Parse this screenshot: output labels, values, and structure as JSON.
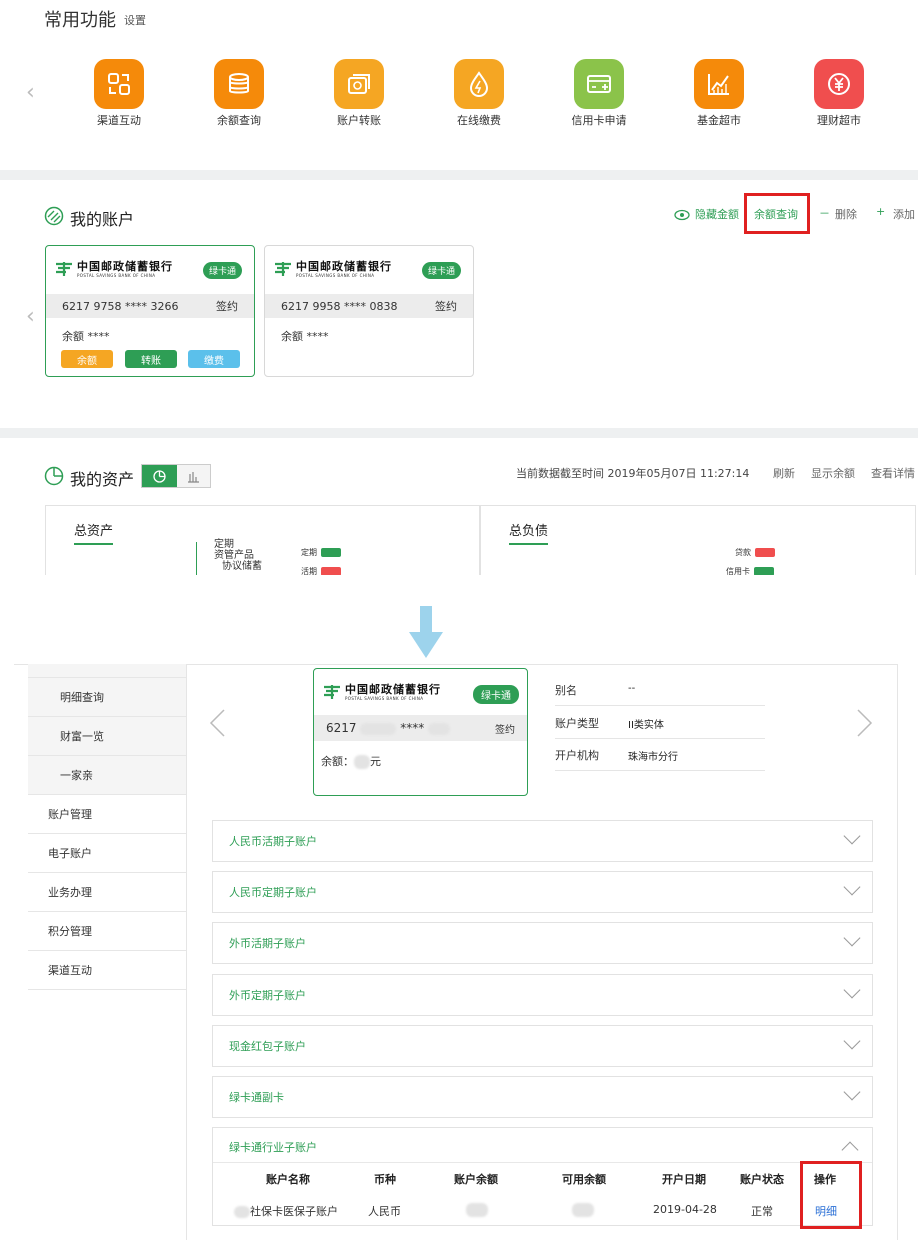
{
  "common": {
    "title": "常用功能",
    "settings": "设置",
    "items": [
      {
        "label": "渠道互动",
        "icon": "channel-interaction-icon",
        "color": "#f58a0a"
      },
      {
        "label": "余额查询",
        "icon": "balance-coins-icon",
        "color": "#f58a0a"
      },
      {
        "label": "账户转账",
        "icon": "transfer-icon",
        "color": "#f5a623"
      },
      {
        "label": "在线缴费",
        "icon": "payment-drop-icon",
        "color": "#f5a623"
      },
      {
        "label": "信用卡申请",
        "icon": "credit-card-icon",
        "color": "#8bc34a"
      },
      {
        "label": "基金超市",
        "icon": "fund-chart-icon",
        "color": "#f58a0a"
      },
      {
        "label": "理财超市",
        "icon": "yuan-coin-icon",
        "color": "#f04e4e"
      }
    ]
  },
  "accounts": {
    "title": "我的账户",
    "actions": {
      "hide": "隐藏金额",
      "query": "余额查询",
      "delete": "删除",
      "add": "添加"
    },
    "bank_name": "中国邮政储蓄银行",
    "bank_en": "POSTAL SAVINGS BANK OF CHINA",
    "cards": [
      {
        "badge": "绿卡通",
        "number": "6217 9758 **** 3266",
        "status": "签约",
        "balance": "余额 ****",
        "buttons": [
          "余额",
          "转账",
          "缴费"
        ]
      },
      {
        "badge": "绿卡通",
        "number": "6217 9958 **** 0838",
        "status": "签约",
        "balance": "余额 ****"
      }
    ]
  },
  "assets": {
    "title": "我的资产",
    "timestamp": "当前数据截至时间 2019年05月07日 11:27:14",
    "actions": {
      "refresh": "刷新",
      "show": "显示余额",
      "detail": "查看详情"
    },
    "total_assets": "总资产",
    "total_liabilities": "总负债",
    "tree": [
      "定期",
      "资管产品",
      "协议储蓄"
    ],
    "legend_left": [
      {
        "label": "定期",
        "color": "#2e9e55"
      },
      {
        "label": "活期",
        "color": "#f04e4e"
      }
    ],
    "legend_right": [
      {
        "label": "贷款",
        "color": "#f04e4e"
      },
      {
        "label": "信用卡",
        "color": "#2e9e55"
      }
    ]
  },
  "sidebar": {
    "sub_items": [
      "明细查询",
      "财富一览",
      "一家亲"
    ],
    "main_items": [
      "账户管理",
      "电子账户",
      "业务办理",
      "积分管理",
      "渠道互动"
    ]
  },
  "detail_card": {
    "badge": "绿卡通",
    "number_prefix": "6217",
    "number_mask": "****",
    "status": "签约",
    "balance_label": "余额：",
    "balance_unit": "元"
  },
  "account_info": [
    {
      "label": "别名",
      "value": "--"
    },
    {
      "label": "账户类型",
      "value": "II类实体"
    },
    {
      "label": "开户机构",
      "value": "珠海市分行"
    }
  ],
  "sub_accounts": [
    "人民币活期子账户",
    "人民币定期子账户",
    "外币活期子账户",
    "外币定期子账户",
    "现金红包子账户",
    "绿卡通副卡"
  ],
  "industry": {
    "title": "绿卡通行业子账户",
    "headers": [
      "账户名称",
      "币种",
      "账户余额",
      "可用余额",
      "开户日期",
      "账户状态",
      "操作"
    ],
    "row": {
      "name": "社保卡医保子账户",
      "currency": "人民币",
      "date": "2019-04-28",
      "status": "正常",
      "action": "明细"
    }
  }
}
